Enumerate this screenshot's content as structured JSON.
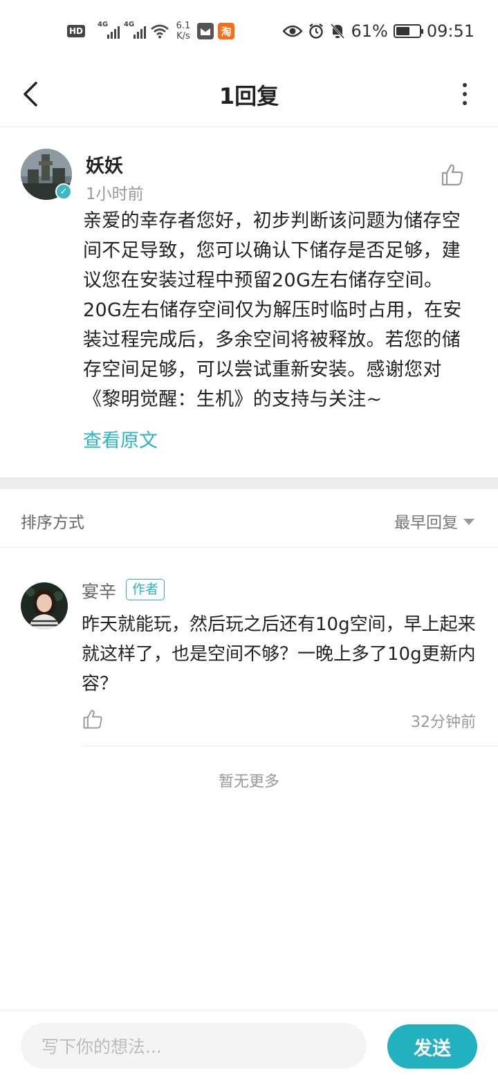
{
  "status_bar": {
    "hd_label": "HD",
    "network_1": "4G",
    "network_2": "4G",
    "speed_value": "6.1",
    "speed_unit": "K/s",
    "taobao_label": "淘",
    "battery_percent": "61%",
    "battery_level": 0.61,
    "time": "09:51"
  },
  "header": {
    "title": "1回复"
  },
  "post": {
    "author": "妖妖",
    "time": "1小时前",
    "body": "亲爱的幸存者您好，初步判断该问题为储存空间不足导致，您可以确认下储存是否足够，建议您在安装过程中预留20G左右储存空间。20G左右储存空间仅为解压时临时占用，在安装过程完成后，多余空间将被释放。若您的储存空间足够，可以尝试重新安装。感谢您对《黎明觉醒：生机》的支持与关注~",
    "view_original": "查看原文"
  },
  "sort": {
    "label": "排序方式",
    "value": "最早回复"
  },
  "reply": {
    "author": "宴辛",
    "badge": "作者",
    "body": "昨天就能玩，然后玩之后还有10g空间，早上起来就这样了，也是空间不够？一晚上多了10g更新内容？",
    "time": "32分钟前"
  },
  "footer_note": "暂无更多",
  "composer": {
    "placeholder": "写下你的想法...",
    "send_label": "发送"
  },
  "colors": {
    "accent": "#29b6c4",
    "send_button": "#22b1bf",
    "divider": "#ececec"
  }
}
